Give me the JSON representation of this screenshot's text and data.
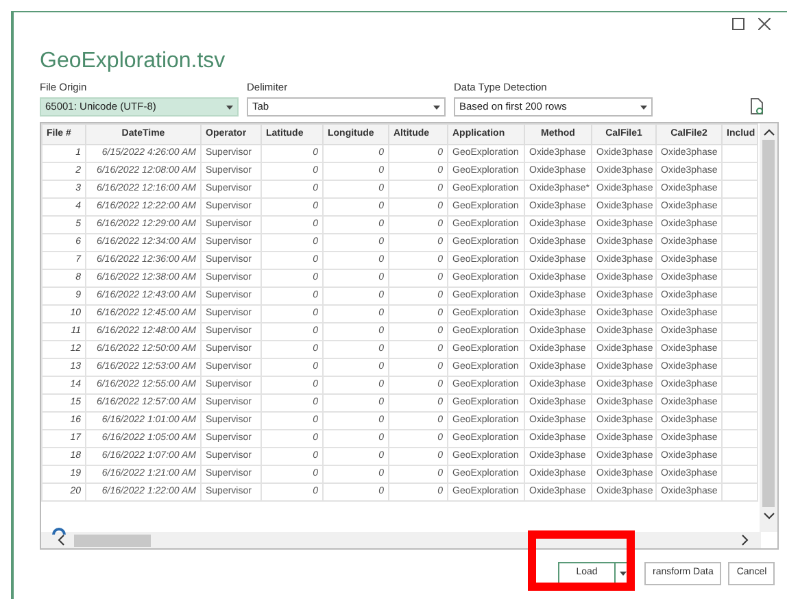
{
  "window": {
    "title": "GeoExploration.tsv"
  },
  "file_origin": {
    "label": "File Origin",
    "value": "65001: Unicode (UTF-8)"
  },
  "delimiter": {
    "label": "Delimiter",
    "value": "Tab"
  },
  "data_type_detection": {
    "label": "Data Type Detection",
    "value": "Based on first 200 rows"
  },
  "table": {
    "columns": [
      "File #",
      "DateTime",
      "Operator",
      "Latitude",
      "Longitude",
      "Altitude",
      "Application",
      "Method",
      "CalFile1",
      "CalFile2",
      "Includ"
    ],
    "rows": [
      [
        "1",
        "6/15/2022 4:26:00 AM",
        "Supervisor",
        "0",
        "0",
        "0",
        "GeoExploration",
        "Oxide3phase",
        "Oxide3phase",
        "Oxide3phase"
      ],
      [
        "2",
        "6/16/2022 12:08:00 AM",
        "Supervisor",
        "0",
        "0",
        "0",
        "GeoExploration",
        "Oxide3phase",
        "Oxide3phase",
        "Oxide3phase"
      ],
      [
        "3",
        "6/16/2022 12:16:00 AM",
        "Supervisor",
        "0",
        "0",
        "0",
        "GeoExploration",
        "Oxide3phase*",
        "Oxide3phase",
        "Oxide3phase"
      ],
      [
        "4",
        "6/16/2022 12:22:00 AM",
        "Supervisor",
        "0",
        "0",
        "0",
        "GeoExploration",
        "Oxide3phase",
        "Oxide3phase",
        "Oxide3phase"
      ],
      [
        "5",
        "6/16/2022 12:29:00 AM",
        "Supervisor",
        "0",
        "0",
        "0",
        "GeoExploration",
        "Oxide3phase",
        "Oxide3phase",
        "Oxide3phase"
      ],
      [
        "6",
        "6/16/2022 12:34:00 AM",
        "Supervisor",
        "0",
        "0",
        "0",
        "GeoExploration",
        "Oxide3phase",
        "Oxide3phase",
        "Oxide3phase"
      ],
      [
        "7",
        "6/16/2022 12:36:00 AM",
        "Supervisor",
        "0",
        "0",
        "0",
        "GeoExploration",
        "Oxide3phase",
        "Oxide3phase",
        "Oxide3phase"
      ],
      [
        "8",
        "6/16/2022 12:38:00 AM",
        "Supervisor",
        "0",
        "0",
        "0",
        "GeoExploration",
        "Oxide3phase",
        "Oxide3phase",
        "Oxide3phase"
      ],
      [
        "9",
        "6/16/2022 12:43:00 AM",
        "Supervisor",
        "0",
        "0",
        "0",
        "GeoExploration",
        "Oxide3phase",
        "Oxide3phase",
        "Oxide3phase"
      ],
      [
        "10",
        "6/16/2022 12:45:00 AM",
        "Supervisor",
        "0",
        "0",
        "0",
        "GeoExploration",
        "Oxide3phase",
        "Oxide3phase",
        "Oxide3phase"
      ],
      [
        "11",
        "6/16/2022 12:48:00 AM",
        "Supervisor",
        "0",
        "0",
        "0",
        "GeoExploration",
        "Oxide3phase",
        "Oxide3phase",
        "Oxide3phase"
      ],
      [
        "12",
        "6/16/2022 12:50:00 AM",
        "Supervisor",
        "0",
        "0",
        "0",
        "GeoExploration",
        "Oxide3phase",
        "Oxide3phase",
        "Oxide3phase"
      ],
      [
        "13",
        "6/16/2022 12:53:00 AM",
        "Supervisor",
        "0",
        "0",
        "0",
        "GeoExploration",
        "Oxide3phase",
        "Oxide3phase",
        "Oxide3phase"
      ],
      [
        "14",
        "6/16/2022 12:55:00 AM",
        "Supervisor",
        "0",
        "0",
        "0",
        "GeoExploration",
        "Oxide3phase",
        "Oxide3phase",
        "Oxide3phase"
      ],
      [
        "15",
        "6/16/2022 12:57:00 AM",
        "Supervisor",
        "0",
        "0",
        "0",
        "GeoExploration",
        "Oxide3phase",
        "Oxide3phase",
        "Oxide3phase"
      ],
      [
        "16",
        "6/16/2022 1:01:00 AM",
        "Supervisor",
        "0",
        "0",
        "0",
        "GeoExploration",
        "Oxide3phase",
        "Oxide3phase",
        "Oxide3phase"
      ],
      [
        "17",
        "6/16/2022 1:05:00 AM",
        "Supervisor",
        "0",
        "0",
        "0",
        "GeoExploration",
        "Oxide3phase",
        "Oxide3phase",
        "Oxide3phase"
      ],
      [
        "18",
        "6/16/2022 1:07:00 AM",
        "Supervisor",
        "0",
        "0",
        "0",
        "GeoExploration",
        "Oxide3phase",
        "Oxide3phase",
        "Oxide3phase"
      ],
      [
        "19",
        "6/16/2022 1:21:00 AM",
        "Supervisor",
        "0",
        "0",
        "0",
        "GeoExploration",
        "Oxide3phase",
        "Oxide3phase",
        "Oxide3phase"
      ],
      [
        "20",
        "6/16/2022 1:22:00 AM",
        "Supervisor",
        "0",
        "0",
        "0",
        "GeoExploration",
        "Oxide3phase",
        "Oxide3phase",
        "Oxide3phase"
      ]
    ]
  },
  "buttons": [
    {
      "kind": "split",
      "label": "Load",
      "default": true
    },
    {
      "kind": "plain",
      "label": "ransform Data",
      "default": false
    },
    {
      "kind": "plain",
      "label": "Cancel",
      "default": false
    }
  ]
}
